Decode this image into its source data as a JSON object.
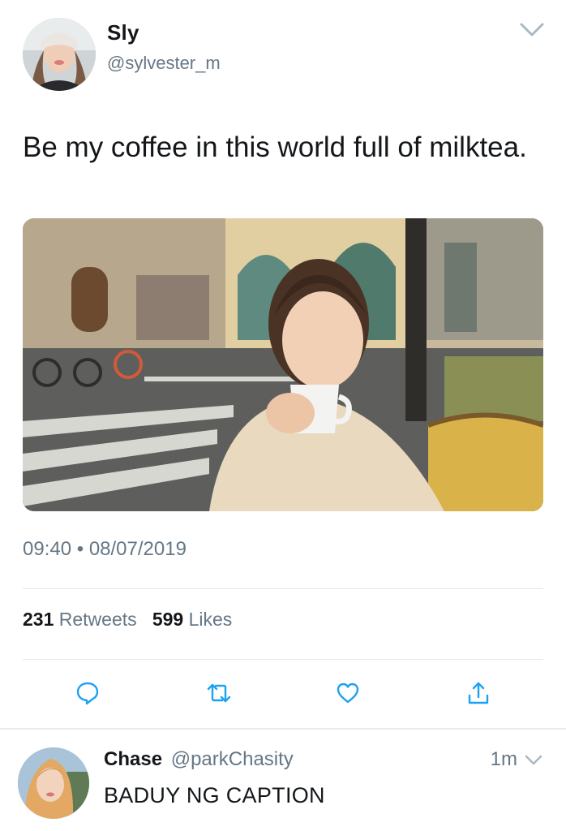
{
  "tweet": {
    "author_name": "Sly",
    "author_handle": "@sylvester_m",
    "text": "Be my coffee in this world full of milktea.",
    "time": "09:40",
    "separator": "•",
    "date": "08/07/2019",
    "retweets_count": "231",
    "retweets_label": "Retweets",
    "likes_count": "599",
    "likes_label": "Likes",
    "actions": [
      "reply-icon",
      "retweet-icon",
      "like-icon",
      "share-icon"
    ]
  },
  "reply": {
    "author_name": "Chase",
    "author_handle": "@parkChasity",
    "time": "1m",
    "text": "BADUY NG CAPTION"
  },
  "colors": {
    "text_primary": "#14171a",
    "text_secondary": "#657786",
    "divider": "#e1e8ed",
    "icon": "#1da1f2"
  }
}
